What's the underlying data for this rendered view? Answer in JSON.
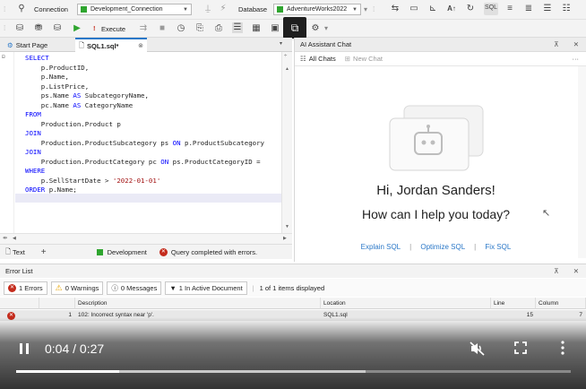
{
  "toolbar": {
    "connection_label": "Connection",
    "connection_value": "Development_Connection",
    "database_label": "Database",
    "database_value": "AdventureWorks2022",
    "execute_label": "Execute",
    "icons": [
      "plug-icon",
      "save-icon",
      "run-icon",
      "stop-icon",
      "refresh-icon",
      "settings-icon",
      "layout-icon"
    ]
  },
  "tabs": [
    {
      "label": "Start Page"
    },
    {
      "label": "SQL1.sql*"
    }
  ],
  "editor": {
    "lines": [
      [
        {
          "t": "SELECT",
          "c": "kw"
        }
      ],
      [
        {
          "t": "    p.ProductID,",
          "c": ""
        }
      ],
      [
        {
          "t": "    p.Name,",
          "c": ""
        }
      ],
      [
        {
          "t": "    p.ListPrice,",
          "c": ""
        }
      ],
      [
        {
          "t": "    ps.Name ",
          "c": ""
        },
        {
          "t": "AS",
          "c": "kw"
        },
        {
          "t": " SubcategoryName,",
          "c": ""
        }
      ],
      [
        {
          "t": "    pc.Name ",
          "c": ""
        },
        {
          "t": "AS",
          "c": "kw"
        },
        {
          "t": " CategoryName",
          "c": ""
        }
      ],
      [
        {
          "t": "FROM",
          "c": "kw"
        }
      ],
      [
        {
          "t": "    Production.Product p",
          "c": ""
        }
      ],
      [
        {
          "t": "JOIN",
          "c": "kw"
        }
      ],
      [
        {
          "t": "    Production.ProductSubcategory ps ",
          "c": ""
        },
        {
          "t": "ON",
          "c": "kw"
        },
        {
          "t": " p.ProductSubcategory",
          "c": ""
        }
      ],
      [
        {
          "t": "JOIN",
          "c": "kw"
        }
      ],
      [
        {
          "t": "    Production.ProductCategory pc ",
          "c": ""
        },
        {
          "t": "ON",
          "c": "kw"
        },
        {
          "t": " ps.ProductCategoryID =",
          "c": ""
        }
      ],
      [
        {
          "t": "WHERE",
          "c": "kw"
        }
      ],
      [
        {
          "t": "    p.SellStartDate > ",
          "c": ""
        },
        {
          "t": "'2022-01-01'",
          "c": "str"
        }
      ],
      [
        {
          "t": "ORDER",
          "c": "kw"
        },
        {
          "t": " p.Name;",
          "c": ""
        }
      ]
    ]
  },
  "editor_status": {
    "text_tab": "Text",
    "environment": "Development",
    "query_status": "Query completed with errors."
  },
  "ai_panel": {
    "title": "AI Assistant Chat",
    "all_chats": "All Chats",
    "new_chat": "New Chat",
    "greeting": "Hi, Jordan Sanders!",
    "subtitle": "How can I help you today?",
    "actions": [
      "Explain SQL",
      "Optimize SQL",
      "Fix SQL"
    ]
  },
  "error_list": {
    "title": "Error List",
    "errors_btn": "1 Errors",
    "warnings_btn": "0 Warnings",
    "messages_btn": "0 Messages",
    "active_doc_btn": "1 In Active Document",
    "items_displayed": "1 of 1 items displayed",
    "columns": [
      "Description",
      "Location",
      "Line",
      "Column"
    ],
    "rows": [
      {
        "num": "1",
        "description": "102: Incorrect syntax near 'p'.",
        "location": "SQL1.sql",
        "line": "15",
        "column": "7"
      }
    ]
  },
  "video": {
    "time": "0:04 / 0:27",
    "progress": 0.185,
    "buffered": 0.63
  },
  "colors": {
    "accent": "#2b78c8",
    "keyword": "#0000ff",
    "string": "#a31515",
    "error": "#c42b1c",
    "env_green": "#2fa52f",
    "progress_red": "#ffffff"
  }
}
